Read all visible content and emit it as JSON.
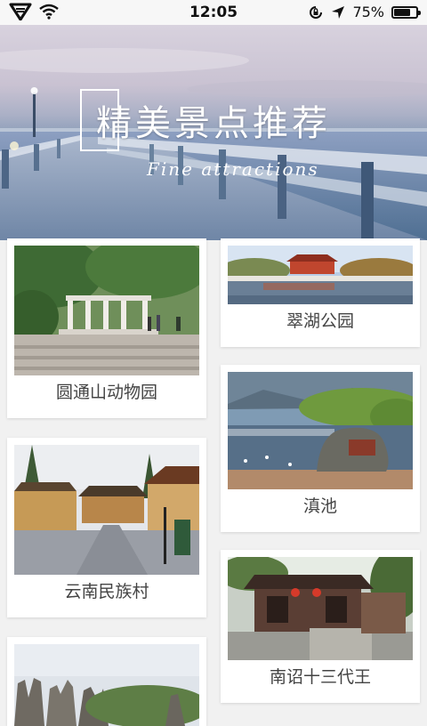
{
  "status_bar": {
    "time": "12:05",
    "battery_text": "75%",
    "battery_level": 0.75,
    "icons": [
      "superman-logo-icon",
      "wifi-icon",
      "rotation-lock-icon",
      "location-arrow-icon",
      "battery-icon"
    ]
  },
  "banner": {
    "title": "精美景点推荐",
    "subtitle": "Fine attractions"
  },
  "attractions": [
    {
      "name": "圆通山动物园"
    },
    {
      "name": "翠湖公园"
    },
    {
      "name": "滇池"
    },
    {
      "name": "云南民族村"
    },
    {
      "name": "南诏十三代王"
    },
    {
      "name": ""
    }
  ],
  "colors": {
    "background": "#f1f1f1",
    "card": "#ffffff",
    "label_text": "#444444"
  }
}
